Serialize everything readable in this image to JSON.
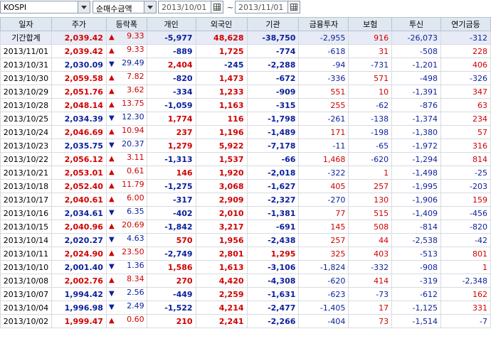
{
  "toolbar": {
    "market": "KOSPI",
    "metric": "순매수금액",
    "start_date": "2013/10/01",
    "separator": "~",
    "end_date": "2013/11/01"
  },
  "table": {
    "headers": [
      "일자",
      "주가",
      "등락폭",
      "개인",
      "외국인",
      "기관",
      "금융투자",
      "보험",
      "투신",
      "연기금등"
    ],
    "rows": [
      {
        "date": "기간합계",
        "price": "2,039.42",
        "dir": "up",
        "change": "9.33",
        "indiv": "-5,977",
        "foreign": "48,628",
        "inst": "-38,750",
        "fin": "-2,955",
        "ins": "916",
        "trust": "-26,073",
        "pension": "-312"
      },
      {
        "date": "2013/11/01",
        "price": "2,039.42",
        "dir": "up",
        "change": "9.33",
        "indiv": "-889",
        "foreign": "1,725",
        "inst": "-774",
        "fin": "-618",
        "ins": "31",
        "trust": "-508",
        "pension": "228"
      },
      {
        "date": "2013/10/31",
        "price": "2,030.09",
        "dir": "down",
        "change": "29.49",
        "indiv": "2,404",
        "foreign": "-245",
        "inst": "-2,288",
        "fin": "-94",
        "ins": "-731",
        "trust": "-1,201",
        "pension": "406"
      },
      {
        "date": "2013/10/30",
        "price": "2,059.58",
        "dir": "up",
        "change": "7.82",
        "indiv": "-820",
        "foreign": "1,473",
        "inst": "-672",
        "fin": "-336",
        "ins": "571",
        "trust": "-498",
        "pension": "-326"
      },
      {
        "date": "2013/10/29",
        "price": "2,051.76",
        "dir": "up",
        "change": "3.62",
        "indiv": "-334",
        "foreign": "1,233",
        "inst": "-909",
        "fin": "551",
        "ins": "10",
        "trust": "-1,391",
        "pension": "347"
      },
      {
        "date": "2013/10/28",
        "price": "2,048.14",
        "dir": "up",
        "change": "13.75",
        "indiv": "-1,059",
        "foreign": "1,163",
        "inst": "-315",
        "fin": "255",
        "ins": "-62",
        "trust": "-876",
        "pension": "63"
      },
      {
        "date": "2013/10/25",
        "price": "2,034.39",
        "dir": "down",
        "change": "12.30",
        "indiv": "1,774",
        "foreign": "116",
        "inst": "-1,798",
        "fin": "-261",
        "ins": "-138",
        "trust": "-1,374",
        "pension": "234"
      },
      {
        "date": "2013/10/24",
        "price": "2,046.69",
        "dir": "up",
        "change": "10.94",
        "indiv": "237",
        "foreign": "1,196",
        "inst": "-1,489",
        "fin": "171",
        "ins": "-198",
        "trust": "-1,380",
        "pension": "57"
      },
      {
        "date": "2013/10/23",
        "price": "2,035.75",
        "dir": "down",
        "change": "20.37",
        "indiv": "1,279",
        "foreign": "5,922",
        "inst": "-7,178",
        "fin": "-11",
        "ins": "-65",
        "trust": "-1,972",
        "pension": "316"
      },
      {
        "date": "2013/10/22",
        "price": "2,056.12",
        "dir": "up",
        "change": "3.11",
        "indiv": "-1,313",
        "foreign": "1,537",
        "inst": "-66",
        "fin": "1,468",
        "ins": "-620",
        "trust": "-1,294",
        "pension": "814"
      },
      {
        "date": "2013/10/21",
        "price": "2,053.01",
        "dir": "up",
        "change": "0.61",
        "indiv": "146",
        "foreign": "1,920",
        "inst": "-2,018",
        "fin": "-322",
        "ins": "1",
        "trust": "-1,498",
        "pension": "-25"
      },
      {
        "date": "2013/10/18",
        "price": "2,052.40",
        "dir": "up",
        "change": "11.79",
        "indiv": "-1,275",
        "foreign": "3,068",
        "inst": "-1,627",
        "fin": "405",
        "ins": "257",
        "trust": "-1,995",
        "pension": "-203"
      },
      {
        "date": "2013/10/17",
        "price": "2,040.61",
        "dir": "up",
        "change": "6.00",
        "indiv": "-317",
        "foreign": "2,909",
        "inst": "-2,327",
        "fin": "-270",
        "ins": "130",
        "trust": "-1,906",
        "pension": "159"
      },
      {
        "date": "2013/10/16",
        "price": "2,034.61",
        "dir": "down",
        "change": "6.35",
        "indiv": "-402",
        "foreign": "2,010",
        "inst": "-1,381",
        "fin": "77",
        "ins": "515",
        "trust": "-1,409",
        "pension": "-456"
      },
      {
        "date": "2013/10/15",
        "price": "2,040.96",
        "dir": "up",
        "change": "20.69",
        "indiv": "-1,842",
        "foreign": "3,217",
        "inst": "-691",
        "fin": "145",
        "ins": "508",
        "trust": "-814",
        "pension": "-820"
      },
      {
        "date": "2013/10/14",
        "price": "2,020.27",
        "dir": "down",
        "change": "4.63",
        "indiv": "570",
        "foreign": "1,956",
        "inst": "-2,438",
        "fin": "257",
        "ins": "44",
        "trust": "-2,538",
        "pension": "-42"
      },
      {
        "date": "2013/10/11",
        "price": "2,024.90",
        "dir": "up",
        "change": "23.50",
        "indiv": "-2,749",
        "foreign": "2,801",
        "inst": "1,295",
        "fin": "325",
        "ins": "403",
        "trust": "-513",
        "pension": "801"
      },
      {
        "date": "2013/10/10",
        "price": "2,001.40",
        "dir": "down",
        "change": "1.36",
        "indiv": "1,586",
        "foreign": "1,613",
        "inst": "-3,106",
        "fin": "-1,824",
        "ins": "-332",
        "trust": "-908",
        "pension": "1"
      },
      {
        "date": "2013/10/08",
        "price": "2,002.76",
        "dir": "up",
        "change": "8.34",
        "indiv": "270",
        "foreign": "4,420",
        "inst": "-4,308",
        "fin": "-620",
        "ins": "414",
        "trust": "-319",
        "pension": "-2,348"
      },
      {
        "date": "2013/10/07",
        "price": "1,994.42",
        "dir": "down",
        "change": "2.56",
        "indiv": "-449",
        "foreign": "2,259",
        "inst": "-1,631",
        "fin": "-623",
        "ins": "-73",
        "trust": "-612",
        "pension": "162"
      },
      {
        "date": "2013/10/04",
        "price": "1,996.98",
        "dir": "down",
        "change": "2.49",
        "indiv": "-1,522",
        "foreign": "4,214",
        "inst": "-2,477",
        "fin": "-1,405",
        "ins": "17",
        "trust": "-1,125",
        "pension": "331"
      },
      {
        "date": "2013/10/02",
        "price": "1,999.47",
        "dir": "up",
        "change": "0.60",
        "indiv": "210",
        "foreign": "2,241",
        "inst": "-2,266",
        "fin": "-404",
        "ins": "73",
        "trust": "-1,514",
        "pension": "-7"
      }
    ]
  },
  "colors": {
    "up": "#d00000",
    "down": "#0a1f9c",
    "header_bg": "#dfe7f1",
    "summary_bg": "#e6ebf5"
  }
}
